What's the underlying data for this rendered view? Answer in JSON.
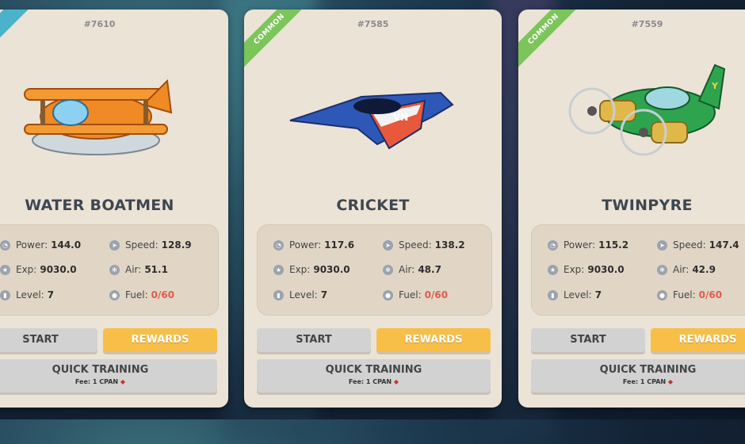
{
  "cards": [
    {
      "id": "#7610",
      "rarity": "",
      "name": "WATER BOATMEN",
      "power_label": "Power:",
      "power": "144.0",
      "speed_label": "Speed:",
      "speed": "128.9",
      "exp_label": "Exp:",
      "exp": "9030.0",
      "air_label": "Air:",
      "air": "51.1",
      "level_label": "Level:",
      "level": "7",
      "fuel_label": "Fuel:",
      "fuel": "0/60",
      "start": "START",
      "rewards": "REWARDS",
      "training": "QUICK TRAINING",
      "fee": "Fee: 1 CPAN"
    },
    {
      "id": "#7585",
      "rarity": "COMMON",
      "name": "CRICKET",
      "power_label": "Power:",
      "power": "117.6",
      "speed_label": "Speed:",
      "speed": "138.2",
      "exp_label": "Exp:",
      "exp": "9030.0",
      "air_label": "Air:",
      "air": "48.7",
      "level_label": "Level:",
      "level": "7",
      "fuel_label": "Fuel:",
      "fuel": "0/60",
      "start": "START",
      "rewards": "REWARDS",
      "training": "QUICK TRAINING",
      "fee": "Fee: 1 CPAN"
    },
    {
      "id": "#7559",
      "rarity": "COMMON",
      "name": "TWINPYRE",
      "power_label": "Power:",
      "power": "115.2",
      "speed_label": "Speed:",
      "speed": "147.4",
      "exp_label": "Exp:",
      "exp": "9030.0",
      "air_label": "Air:",
      "air": "42.9",
      "level_label": "Level:",
      "level": "7",
      "fuel_label": "Fuel:",
      "fuel": "0/60",
      "start": "START",
      "rewards": "REWARDS",
      "training": "QUICK TRAINING",
      "fee": "Fee: 1 CPAN"
    }
  ],
  "colors": {
    "card_bg": "#ece3d7",
    "rewards": "#f7be48",
    "common_ribbon": "#7cc55a",
    "fuel_empty": "#e05a4e"
  },
  "icons": [
    "power-gauge-icon",
    "speed-icon",
    "exp-star-icon",
    "air-fan-icon",
    "level-bars-icon",
    "fuel-drop-icon",
    "cpan-token-icon"
  ]
}
